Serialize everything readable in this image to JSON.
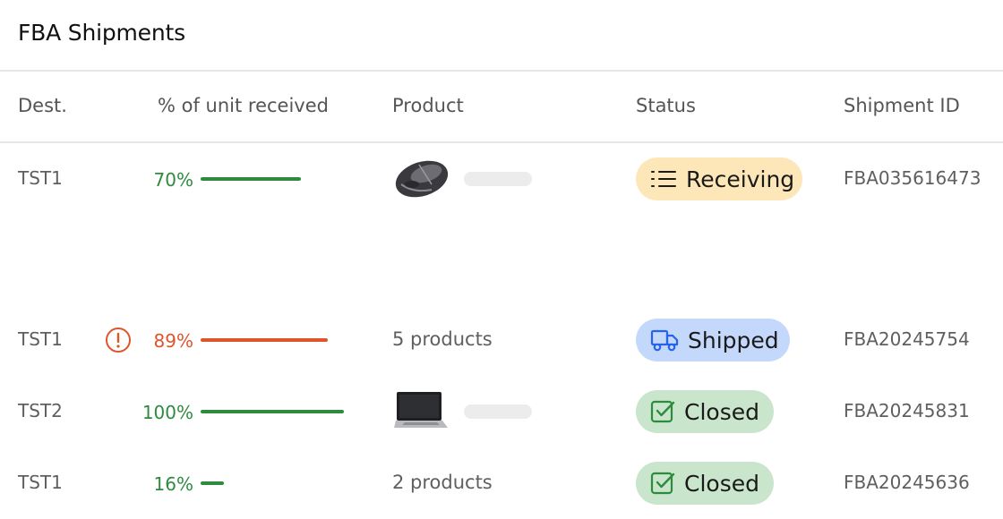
{
  "header": {
    "title": "FBA Shipments"
  },
  "columns": {
    "dest": "Dest.",
    "received": "% of unit received",
    "product": "Product",
    "status": "Status",
    "shipment_id": "Shipment ID"
  },
  "colors": {
    "green": "#2e8b3e",
    "red": "#e0542b",
    "receiving_bg": "#fde7b8",
    "shipped_bg": "#c4d8fb",
    "closed_bg": "#c9e5cb"
  },
  "rows": [
    {
      "dest": "TST1",
      "percent_label": "70%",
      "percent": 70,
      "product_type": "image",
      "product_icon": "mouse-thumbnail",
      "status": "Receiving",
      "status_icon": "list-icon",
      "shipment_id": "FBA035616473",
      "warning": false
    },
    {
      "dest": "TST1",
      "percent_label": "89%",
      "percent": 89,
      "product_type": "text",
      "product_text": "5 products",
      "status": "Shipped",
      "status_icon": "truck-icon",
      "shipment_id": "FBA20245754",
      "warning": true
    },
    {
      "dest": "TST2",
      "percent_label": "100%",
      "percent": 100,
      "product_type": "image",
      "product_icon": "laptop-thumbnail",
      "status": "Closed",
      "status_icon": "checkbox-icon",
      "shipment_id": "FBA20245831",
      "warning": false
    },
    {
      "dest": "TST1",
      "percent_label": "16%",
      "percent": 16,
      "product_type": "text",
      "product_text": "2 products",
      "status": "Closed",
      "status_icon": "checkbox-icon",
      "shipment_id": "FBA20245636",
      "warning": false
    }
  ]
}
